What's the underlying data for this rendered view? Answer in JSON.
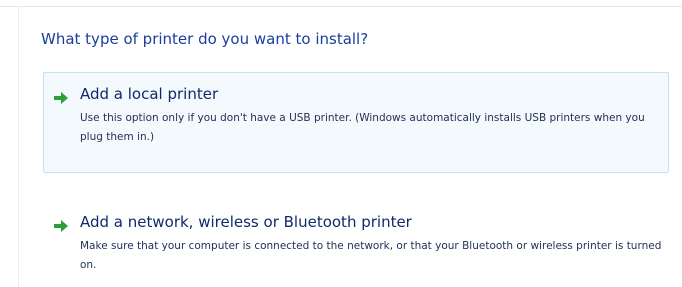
{
  "wizard": {
    "heading": "What type of printer do you want to install?",
    "options": [
      {
        "icon": "green-arrow-icon",
        "title": "Add a local printer",
        "description": "Use this option only if you don't have a USB printer. (Windows automatically installs USB printers when you plug them in.)"
      },
      {
        "icon": "green-arrow-icon",
        "title": "Add a network, wireless or Bluetooth printer",
        "description": "Make sure that your computer is connected to the network, or that your Bluetooth or wireless printer is turned on."
      }
    ]
  },
  "colors": {
    "heading": "#1a3e9e",
    "arrow": "#2e9e3a",
    "selected_border": "#bfe3ef",
    "selected_background": "#f3f9fc"
  }
}
